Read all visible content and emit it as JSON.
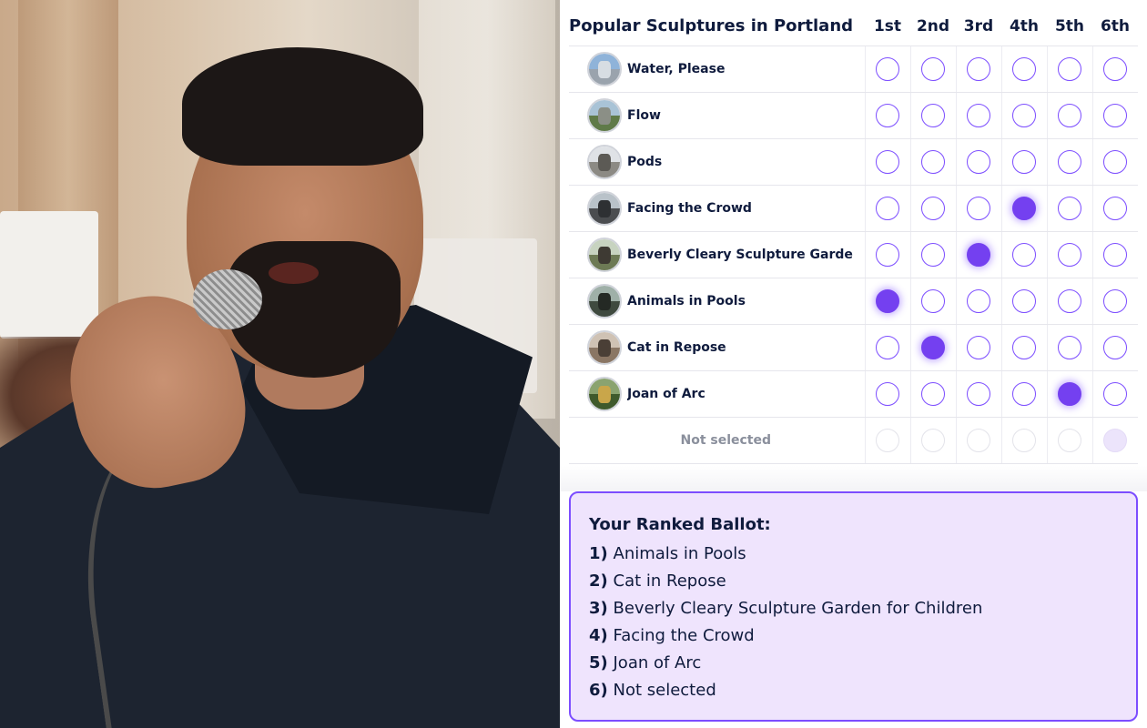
{
  "grid": {
    "title": "Popular Sculptures in Portland",
    "rank_headers": [
      "1st",
      "2nd",
      "3rd",
      "4th",
      "5th",
      "6th"
    ],
    "rows": [
      {
        "name": "Water, Please",
        "selected_rank": null,
        "thumb": {
          "sky": "#8fb3d9",
          "ground": "#9aa3ad",
          "obj": "#d7dde3"
        }
      },
      {
        "name": "Flow",
        "selected_rank": null,
        "thumb": {
          "sky": "#a9c3d6",
          "ground": "#5f7a48",
          "obj": "#8b8f86"
        }
      },
      {
        "name": "Pods",
        "selected_rank": null,
        "thumb": {
          "sky": "#dfe2e6",
          "ground": "#8c8a84",
          "obj": "#5c5a55"
        }
      },
      {
        "name": "Facing the Crowd",
        "selected_rank": 4,
        "thumb": {
          "sky": "#b9c2c9",
          "ground": "#4b4d50",
          "obj": "#2e3033"
        }
      },
      {
        "name": "Beverly Cleary Sculpture Garden for Children",
        "selected_rank": 3,
        "thumb": {
          "sky": "#c7d3c0",
          "ground": "#6d7a55",
          "obj": "#3e3a33"
        }
      },
      {
        "name": "Animals in Pools",
        "selected_rank": 1,
        "thumb": {
          "sky": "#9fb0a8",
          "ground": "#3f4a3f",
          "obj": "#242924"
        }
      },
      {
        "name": "Cat in Repose",
        "selected_rank": 2,
        "thumb": {
          "sky": "#cfc2b4",
          "ground": "#8a7664",
          "obj": "#4a3f36"
        }
      },
      {
        "name": "Joan of Arc",
        "selected_rank": 5,
        "thumb": {
          "sky": "#8aa370",
          "ground": "#3f5a2c",
          "obj": "#c9a64a"
        }
      }
    ],
    "not_selected": {
      "label": "Not selected",
      "selected_rank": 6
    }
  },
  "ballot": {
    "heading": "Your Ranked Ballot:",
    "items": [
      {
        "num": "1)",
        "text": "Animals in Pools"
      },
      {
        "num": "2)",
        "text": "Cat in Repose"
      },
      {
        "num": "3)",
        "text": "Beverly Cleary Sculpture Garden for Children"
      },
      {
        "num": "4)",
        "text": "Facing the Crowd"
      },
      {
        "num": "5)",
        "text": "Joan of Arc"
      },
      {
        "num": "6)",
        "text": "Not selected"
      }
    ]
  },
  "colors": {
    "accent": "#7440f0",
    "ballot_bg": "#efe4fd",
    "text": "#0f1b3d"
  }
}
